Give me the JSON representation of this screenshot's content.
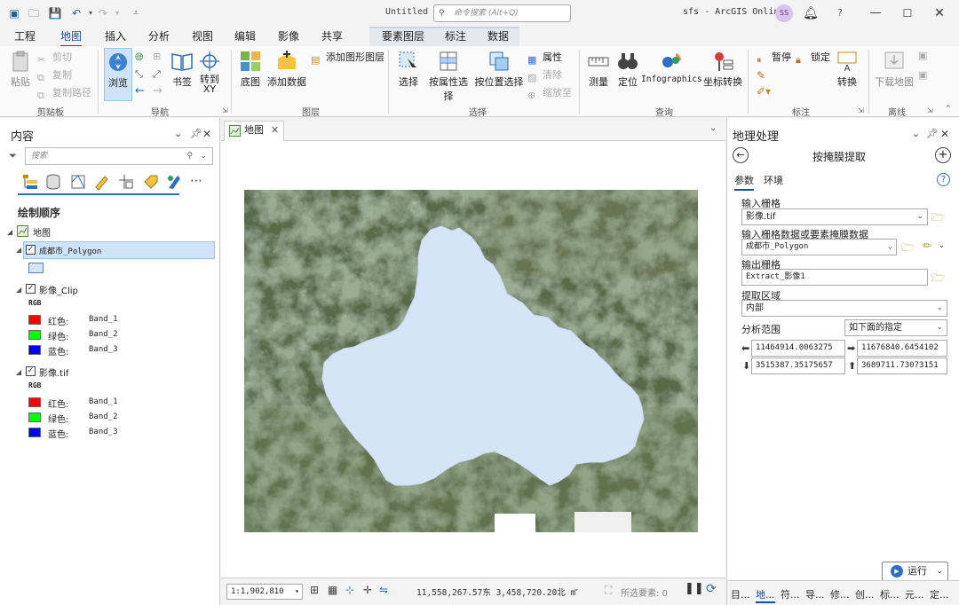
{
  "titlebar": {
    "document_title": "Untitled",
    "command_search_placeholder": "命令搜索 (Alt+Q)",
    "project_name": "sfs - ArcGIS Online",
    "user_initials": "SS",
    "help_label": "?"
  },
  "tabs": {
    "items": [
      "工程",
      "地图",
      "插入",
      "分析",
      "视图",
      "编辑",
      "影像",
      "共享"
    ],
    "active": "地图",
    "contextual": [
      "要素图层",
      "标注",
      "数据"
    ]
  },
  "ribbon": {
    "clipboard": {
      "label": "剪贴板",
      "paste": "粘贴",
      "cut": "剪切",
      "copy": "复制",
      "copy_path": "复制路径"
    },
    "navigate": {
      "label": "导航",
      "explore": "浏览",
      "bookmarks": "书签",
      "goto_xy": "转到\nXY"
    },
    "layer": {
      "label": "图层",
      "basemap": "底图",
      "add_data": "添加数据",
      "add_graphics_layer": "添加图形图层"
    },
    "selection": {
      "label": "选择",
      "select": "选择",
      "select_by_attributes": "按属性选择",
      "select_by_location": "按位置选择",
      "attributes": "属性",
      "clear": "清除",
      "zoom_to": "缩放至"
    },
    "inquiry": {
      "label": "查询",
      "measure": "测量",
      "locate": "定位",
      "infographics": "Infographics",
      "coordinate_conversion": "坐标转换"
    },
    "labeling": {
      "label": "标注",
      "pause": "暂停",
      "lock": "锁定",
      "convert": "转换"
    },
    "offline": {
      "label": "离线",
      "download_map": "下载地图"
    }
  },
  "contents": {
    "title": "内容",
    "search_placeholder": "搜索",
    "drawing_order": "绘制顺序",
    "map_name": "地图",
    "layers": [
      {
        "name": "成都市_Polygon",
        "checked": true,
        "selected": true
      },
      {
        "name": "影像_Clip",
        "checked": true,
        "rgb_label": "RGB",
        "bands": [
          {
            "channel": "红色:",
            "band": "Band_1",
            "color": "#ff0000"
          },
          {
            "channel": "绿色:",
            "band": "Band_2",
            "color": "#00ff00"
          },
          {
            "channel": "蓝色:",
            "band": "Band_3",
            "color": "#0000ff"
          }
        ]
      },
      {
        "name": "影像.tif",
        "checked": true,
        "rgb_label": "RGB",
        "bands": [
          {
            "channel": "红色:",
            "band": "Band_1",
            "color": "#ff0000"
          },
          {
            "channel": "绿色:",
            "band": "Band_2",
            "color": "#00ff00"
          },
          {
            "channel": "蓝色:",
            "band": "Band_3",
            "color": "#0000ff"
          }
        ]
      }
    ],
    "polygon_fill": "#d6e4f7"
  },
  "map_view": {
    "tab_label": "地图",
    "scale": "1:1,902,810",
    "coordinates": "11,558,267.57东 3,458,720.20北 m",
    "selected_features": "所选要素: 0"
  },
  "geoprocessing": {
    "title": "地理处理",
    "tool_name": "按掩膜提取",
    "tab_parameters": "参数",
    "tab_environments": "环境",
    "input_raster_label": "输入栅格",
    "input_raster_value": "影像.tif",
    "mask_label": "输入栅格数据或要素掩膜数据",
    "mask_value": "成都市_Polygon",
    "output_label": "输出栅格",
    "output_value": "Extract_影像1",
    "extraction_area_label": "提取区域",
    "extraction_area_value": "内部",
    "analysis_extent_label": "分析范围",
    "analysis_extent_value": "如下面的指定",
    "extent_left": "11464914.0063275",
    "extent_right": "11676840.6454102",
    "extent_bottom": "3515387.35175657",
    "extent_top": "3689711.73073151",
    "run_label": "运行",
    "bottom_tabs": [
      "目...",
      "地...",
      "符...",
      "导...",
      "修...",
      "创...",
      "标...",
      "元...",
      "定..."
    ]
  }
}
